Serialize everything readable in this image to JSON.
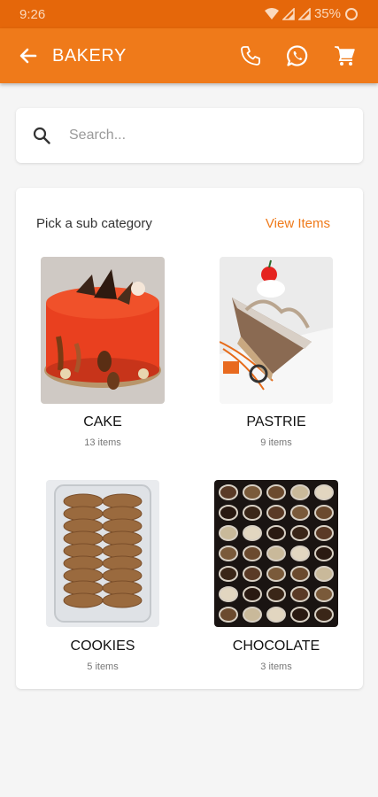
{
  "status_bar": {
    "time": "9:26",
    "battery": "35%"
  },
  "app_bar": {
    "title": "BAKERY"
  },
  "search": {
    "placeholder": "Search..."
  },
  "categories_section": {
    "heading": "Pick a sub category",
    "view_items_label": "View Items",
    "items": [
      {
        "name": "CAKE",
        "count": "13 items"
      },
      {
        "name": "PASTRIE",
        "count": "9 items"
      },
      {
        "name": "COOKIES",
        "count": "5 items"
      },
      {
        "name": "CHOCOLATE",
        "count": "3 items"
      }
    ]
  },
  "colors": {
    "status_bar": "#e5670a",
    "app_bar": "#ef7a1a",
    "accent": "#ef7a1a"
  }
}
